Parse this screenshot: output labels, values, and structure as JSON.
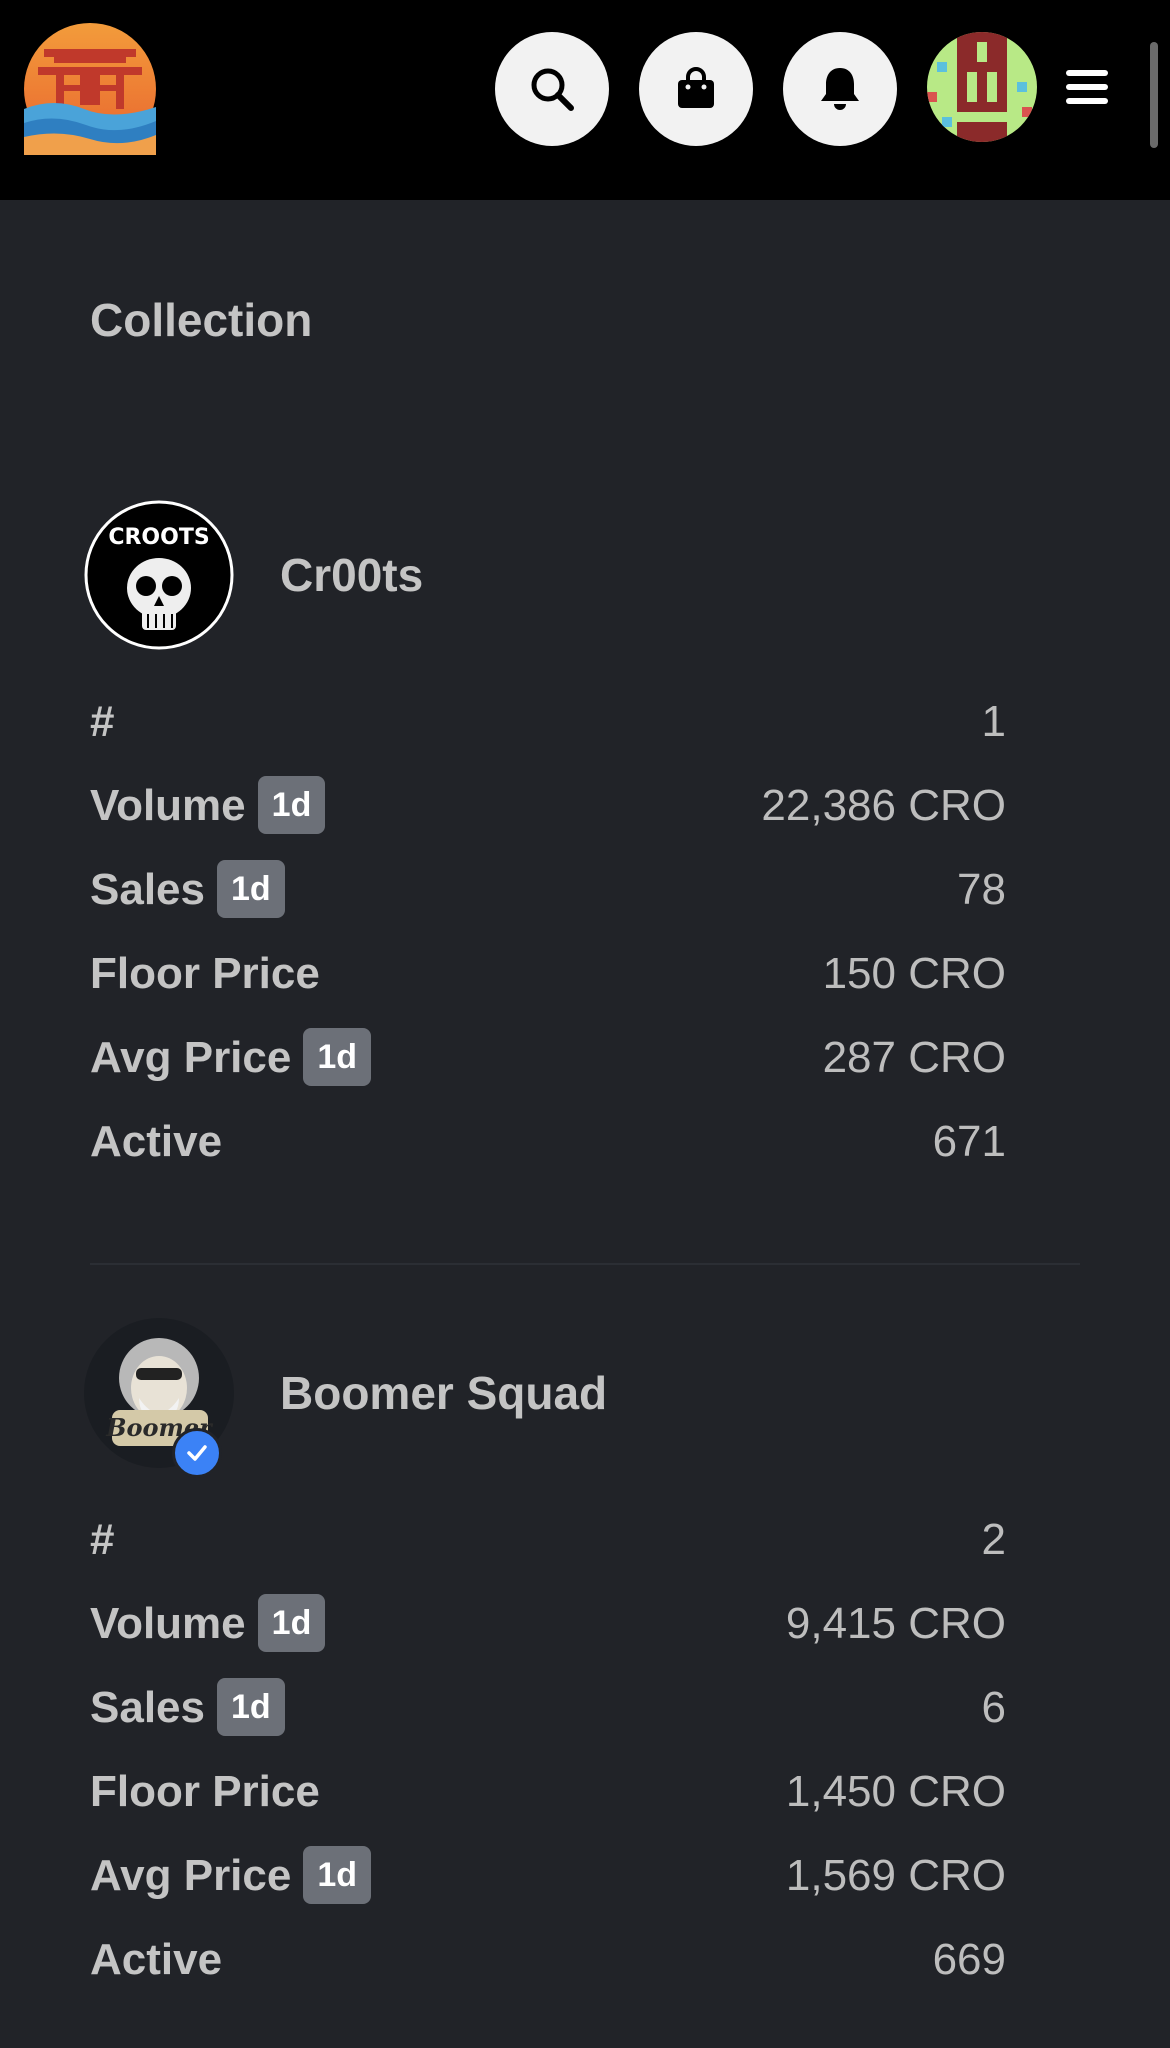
{
  "header": {
    "logo_icon": "pagoda-waves-logo",
    "buttons": [
      {
        "icon": "search-icon"
      },
      {
        "icon": "shopping-bag-icon"
      },
      {
        "icon": "bell-icon"
      }
    ],
    "avatar_icon": "pixel-avatar",
    "menu_icon": "hamburger-menu-icon"
  },
  "page": {
    "section_title": "Collection"
  },
  "collections": [
    {
      "name": "Cr00ts",
      "verified": false,
      "avatar_label": "CROOTS",
      "stats": [
        {
          "label": "#",
          "badge": "",
          "value": "1"
        },
        {
          "label": "Volume",
          "badge": "1d",
          "value": "22,386 CRO"
        },
        {
          "label": "Sales",
          "badge": "1d",
          "value": "78"
        },
        {
          "label": "Floor Price",
          "badge": "",
          "value": "150 CRO"
        },
        {
          "label": "Avg Price",
          "badge": "1d",
          "value": "287 CRO"
        },
        {
          "label": "Active",
          "badge": "",
          "value": "671"
        }
      ]
    },
    {
      "name": "Boomer Squad",
      "verified": true,
      "avatar_label": "Boomer",
      "stats": [
        {
          "label": "#",
          "badge": "",
          "value": "2"
        },
        {
          "label": "Volume",
          "badge": "1d",
          "value": "9,415 CRO"
        },
        {
          "label": "Sales",
          "badge": "1d",
          "value": "6"
        },
        {
          "label": "Floor Price",
          "badge": "",
          "value": "1,450 CRO"
        },
        {
          "label": "Avg Price",
          "badge": "1d",
          "value": "1,569 CRO"
        },
        {
          "label": "Active",
          "badge": "",
          "value": "669"
        }
      ]
    }
  ],
  "colors": {
    "background": "#212328",
    "header": "#000000",
    "badge": "#6c7078",
    "verified": "#3b82f6"
  }
}
